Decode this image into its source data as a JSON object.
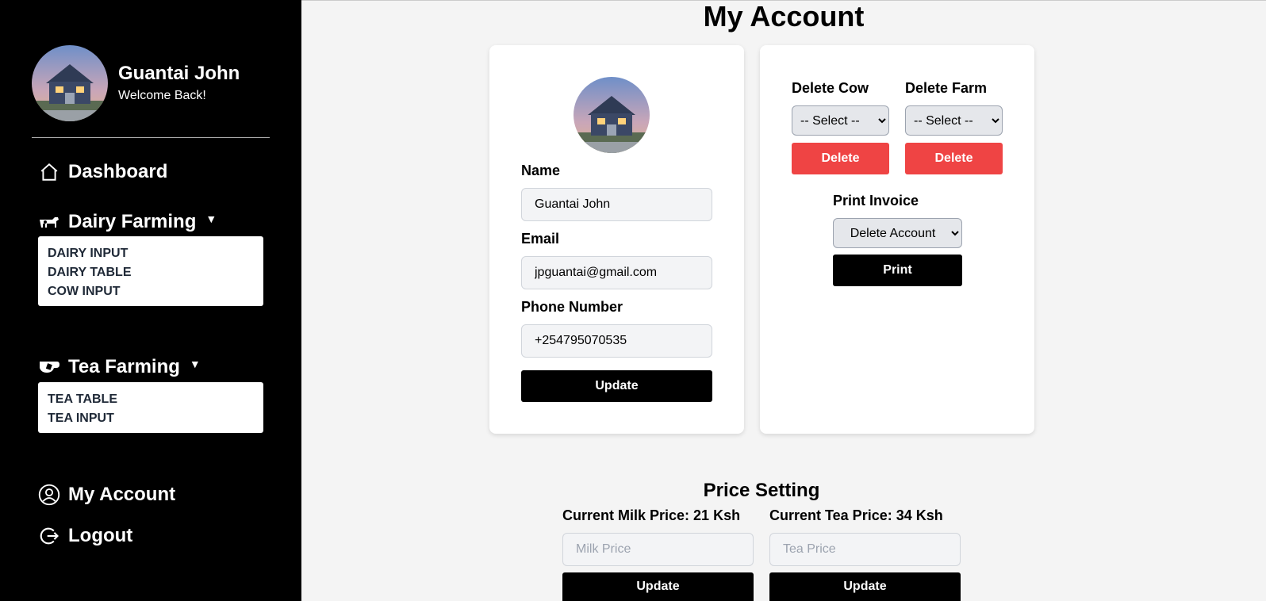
{
  "sidebar": {
    "user_name": "Guantai John",
    "welcome": "Welcome Back!",
    "nav": {
      "dashboard": "Dashboard",
      "dairy": "Dairy Farming",
      "tea": "Tea Farming",
      "account": "My Account",
      "logout": "Logout"
    },
    "dairy_items": [
      "DAIRY INPUT",
      "DAIRY TABLE",
      "COW INPUT"
    ],
    "tea_items": [
      "TEA TABLE",
      "TEA INPUT"
    ],
    "caret": "▼"
  },
  "page": {
    "title": "My Account"
  },
  "profile_form": {
    "name_label": "Name",
    "name_value": "Guantai John",
    "email_label": "Email",
    "email_value": "jpguantai@gmail.com",
    "phone_label": "Phone Number",
    "phone_value": "+254795070535",
    "update_label": "Update"
  },
  "delete_panel": {
    "cow_label": "Delete Cow",
    "farm_label": "Delete Farm",
    "select_placeholder": "-- Select --",
    "delete_label": "Delete",
    "invoice_label": "Print Invoice",
    "invoice_option": "Delete Account",
    "print_label": "Print"
  },
  "price_setting": {
    "title": "Price Setting",
    "milk_label": "Current Milk Price: 21 Ksh",
    "milk_placeholder": "Milk Price",
    "tea_label": "Current Tea Price: 34 Ksh",
    "tea_placeholder": "Tea Price",
    "update_label": "Update"
  },
  "colors": {
    "sidebar_bg": "#000000",
    "delete_button": "#ef4444",
    "primary_button": "#000000",
    "page_bg": "#f4f4f4"
  },
  "icons": {
    "dashboard": "home-icon",
    "dairy": "cow-icon",
    "tea": "tea-cup-icon",
    "account": "user-circle-icon",
    "logout": "logout-icon"
  }
}
